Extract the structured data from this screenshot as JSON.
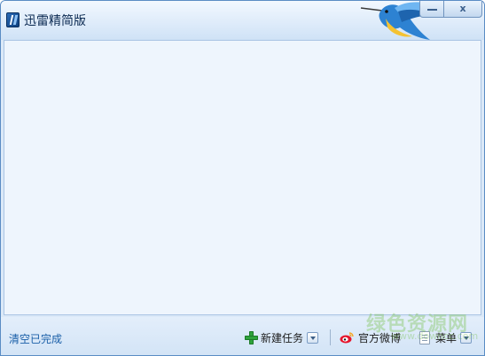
{
  "window": {
    "title": "迅雷精简版",
    "close_glyph": "x"
  },
  "statusbar": {
    "clear_completed": "清空已完成",
    "new_task": "新建任务",
    "official_weibo": "官方微博",
    "menu": "菜单"
  },
  "watermark": {
    "main": "绿色资源网",
    "sub": "www.downcc.com"
  },
  "colors": {
    "accent": "#5a8cc4",
    "link": "#1a5fa8",
    "plus_green": "#2fa33c",
    "weibo_red": "#e6162d"
  },
  "icons": {
    "app": "xunlei-logo-icon",
    "mascot": "hummingbird-mascot",
    "new_task": "plus-icon",
    "weibo": "weibo-icon",
    "menu": "document-menu-icon"
  }
}
